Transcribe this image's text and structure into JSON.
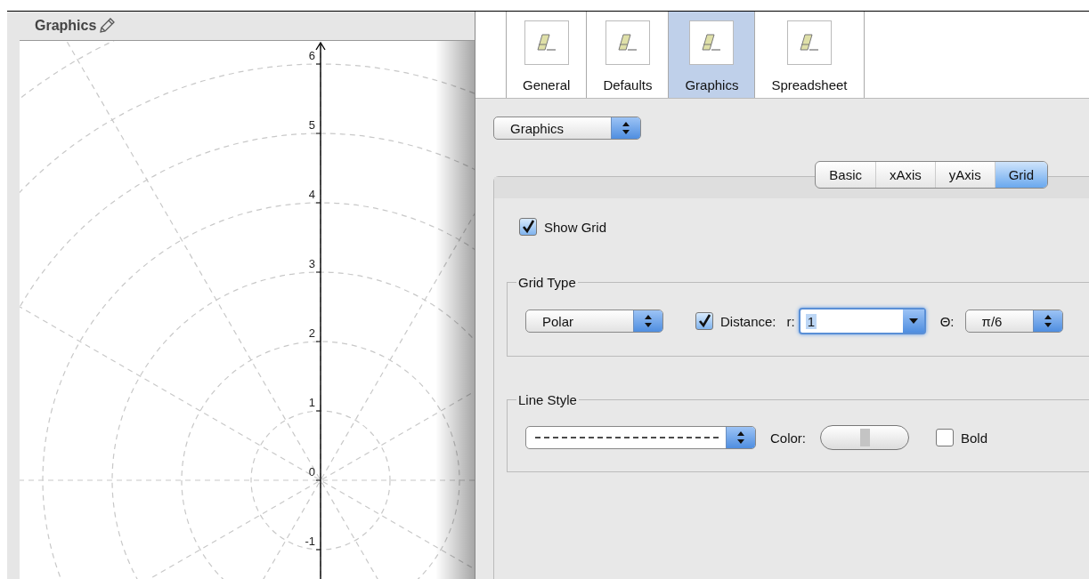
{
  "graphics_view": {
    "title": "Graphics",
    "y_tick_labels": [
      "6",
      "5",
      "4",
      "3",
      "2",
      "1",
      "0",
      "-1"
    ]
  },
  "categories": [
    {
      "label": "General",
      "selected": false
    },
    {
      "label": "Defaults",
      "selected": false
    },
    {
      "label": "Graphics",
      "selected": true
    },
    {
      "label": "Spreadsheet",
      "selected": false
    }
  ],
  "view_select": {
    "value": "Graphics"
  },
  "tabs": [
    {
      "label": "Basic",
      "selected": false
    },
    {
      "label": "xAxis",
      "selected": false
    },
    {
      "label": "yAxis",
      "selected": false
    },
    {
      "label": "Grid",
      "selected": true
    }
  ],
  "show_grid": {
    "label": "Show Grid",
    "checked": true
  },
  "grid_type": {
    "title": "Grid Type",
    "type_select": "Polar",
    "distance": {
      "label": "Distance:",
      "checked": true
    },
    "r_label": "r:",
    "r_value": "1",
    "theta_label": "Θ:",
    "theta_select": "π/6"
  },
  "line_style": {
    "title": "Line Style",
    "color_label": "Color:",
    "bold": {
      "label": "Bold",
      "checked": false
    }
  }
}
